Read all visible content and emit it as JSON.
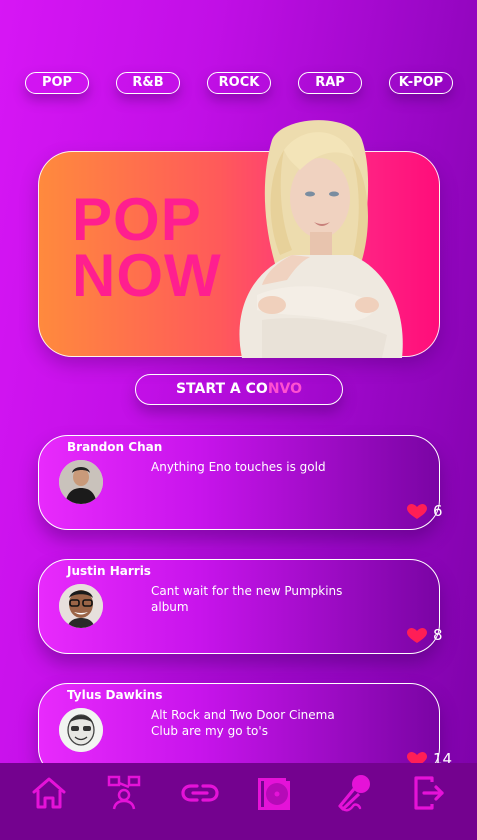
{
  "genres": [
    "POP",
    "R&B",
    "ROCK",
    "RAP",
    "K-POP"
  ],
  "hero": {
    "title": "POP\nNOW"
  },
  "convo_button": {
    "label_a": "START A CO",
    "label_b": "NVO"
  },
  "posts": [
    {
      "author": "Brandon Chan",
      "message": "Anything Eno touches is gold",
      "likes": "6"
    },
    {
      "author": "Justin Harris",
      "message": "Cant wait for the new Pumpkins album",
      "likes": "8"
    },
    {
      "author": "Tylus Dawkins",
      "message": "Alt Rock and Two Door Cinema Club are my go to's",
      "likes": "14"
    }
  ],
  "nav": [
    {
      "icon": "home-icon"
    },
    {
      "icon": "community-icon"
    },
    {
      "icon": "link-icon"
    },
    {
      "icon": "album-icon"
    },
    {
      "icon": "microphone-icon"
    },
    {
      "icon": "logout-icon"
    }
  ],
  "colors": {
    "accent": "#ff1f8f",
    "nav_icon": "#e512d8",
    "heart": "#ff1e56",
    "navbar_bg": "#74028f"
  }
}
